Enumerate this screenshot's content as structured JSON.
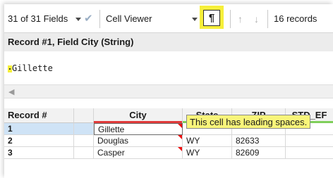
{
  "toolbar": {
    "fields_label": "31 of 31 Fields",
    "cell_viewer_label": "Cell Viewer",
    "pilcrow": "¶",
    "up_arrow": "↑",
    "down_arrow": "↓",
    "records_label": "16 records",
    "checkmark": "✔"
  },
  "record_header": "Record #1, Field City (String)",
  "viewer": {
    "text": "Gillette"
  },
  "scroll": {
    "left_arrow": "◀"
  },
  "columns": [
    "Record #",
    "City",
    "State",
    "ZIP",
    "STD_EF"
  ],
  "rows": [
    {
      "record": "1",
      "city": "Gillette",
      "state": "",
      "zip": ""
    },
    {
      "record": "2",
      "city": "Douglas",
      "state": "WY",
      "zip": "82633"
    },
    {
      "record": "3",
      "city": "Casper",
      "state": "WY",
      "zip": "82609"
    }
  ],
  "tooltip": "This cell has leading spaces.",
  "colors": {
    "highlight_yellow": "#f6ef3a",
    "city_underline": "#e23b3b",
    "other_underline": "#7fcf5a",
    "selected_row": "#cfe3f6"
  }
}
